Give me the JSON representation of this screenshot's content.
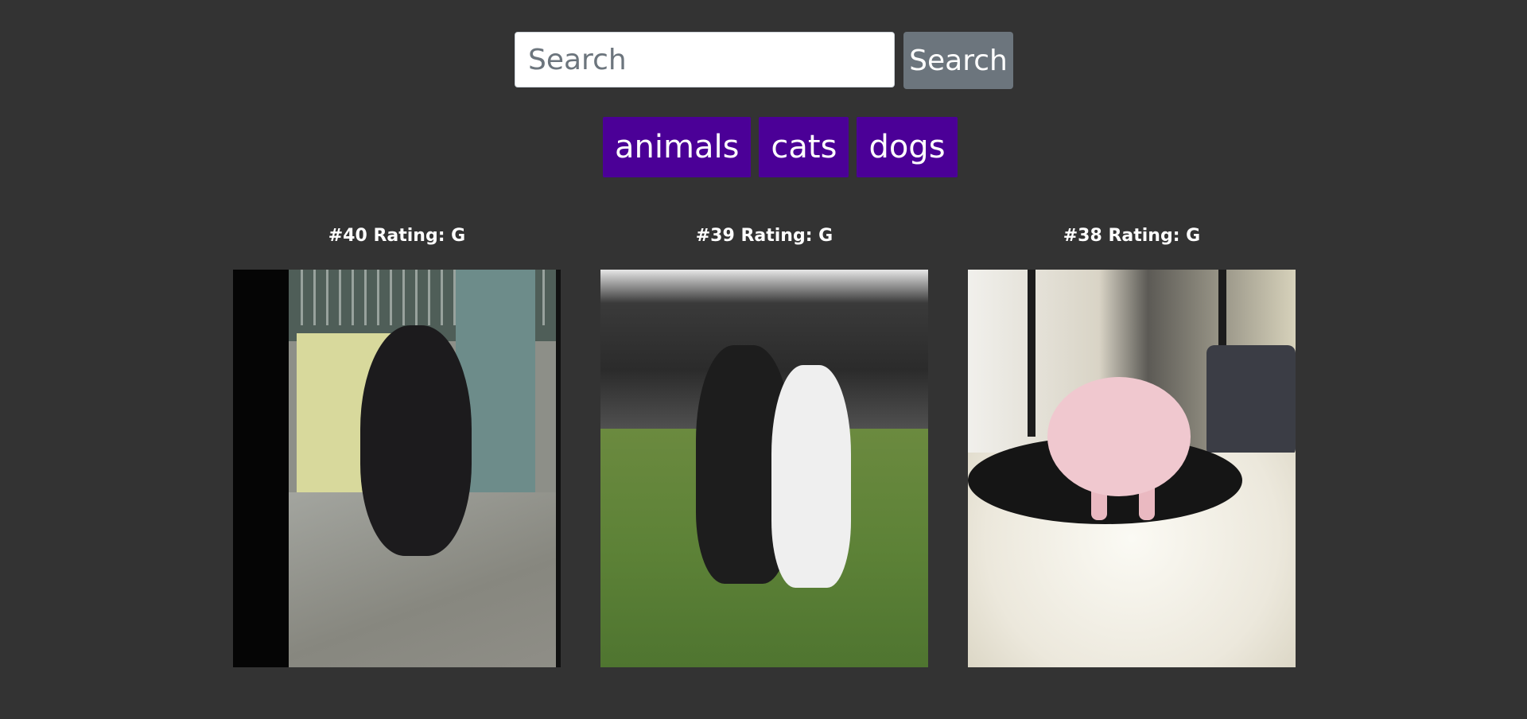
{
  "search": {
    "placeholder": "Search",
    "value": "",
    "button_label": "Search"
  },
  "tags": [
    {
      "label": "animals"
    },
    {
      "label": "cats"
    },
    {
      "label": "dogs"
    }
  ],
  "gifs": [
    {
      "caption": "#40 Rating: G",
      "subject": "gorilla"
    },
    {
      "caption": "#39 Rating: G",
      "subject": "two dogs"
    },
    {
      "caption": "#38 Rating: G",
      "subject": "pig and cat"
    }
  ],
  "colors": {
    "background": "#333333",
    "tag_button": "#4b0097",
    "search_button": "#6c757d"
  }
}
